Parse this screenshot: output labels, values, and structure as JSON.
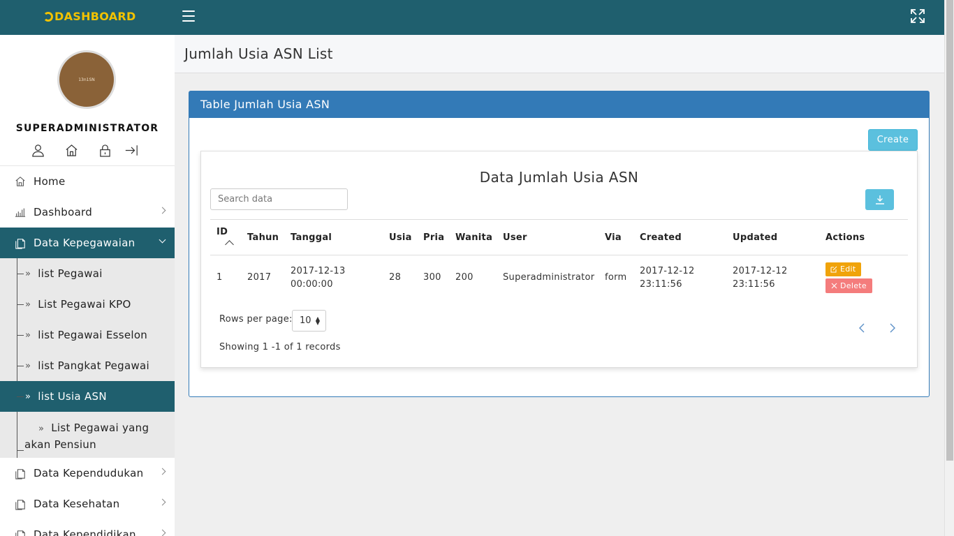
{
  "app": {
    "brand": "DASHBOARD"
  },
  "topbar": {
    "menu_icon": "hamburger-icon",
    "fullscreen_icon": "expand-icon"
  },
  "sidebar": {
    "avatar_text": "13n1SN",
    "username": "SUPERADMINISTRATOR",
    "profile_icons": [
      "user-icon",
      "home-icon",
      "lock-icon",
      "logout-icon"
    ],
    "menu": [
      {
        "label": "Home",
        "icon": "home-icon"
      },
      {
        "label": "Dashboard",
        "icon": "chart-icon"
      },
      {
        "label": "Data Kepegawaian",
        "icon": "docs-icon"
      }
    ],
    "submenu": [
      {
        "label": "list Pegawai"
      },
      {
        "label": "List Pegawai KPO"
      },
      {
        "label": "list Pegawai Esselon"
      },
      {
        "label": "list Pangkat Pegawai"
      },
      {
        "label": "list Usia ASN"
      },
      {
        "label": "List Pegawai yang akan Pensiun"
      }
    ],
    "menu_after": [
      {
        "label": "Data Kependudukan",
        "icon": "docs-icon"
      },
      {
        "label": "Data Kesehatan",
        "icon": "docs-icon"
      },
      {
        "label": "Data Kependidikan",
        "icon": "docs-icon"
      }
    ]
  },
  "page": {
    "title": "Jumlah Usia ASN List"
  },
  "panel": {
    "title": "Table Jumlah Usia ASN",
    "create_label": "Create",
    "card_title": "Data Jumlah Usia ASN",
    "search_placeholder": "Search data",
    "table": {
      "columns": [
        "ID",
        "Tahun",
        "Tanggal",
        "Usia",
        "Pria",
        "Wanita",
        "User",
        "Via",
        "Created",
        "Updated",
        "Actions"
      ],
      "rows": [
        {
          "id": "1",
          "tahun": "2017",
          "tanggal_date": "2017-12-13",
          "tanggal_time": "00:00:00",
          "usia": "28",
          "pria": "300",
          "wanita": "200",
          "user": "Superadministrator",
          "via": "form",
          "created_date": "2017-12-12",
          "created_time": "23:11:56",
          "updated_date": "2017-12-12",
          "updated_time": "23:11:56"
        }
      ],
      "edit_label": "Edit",
      "delete_label": "Delete"
    },
    "rows_per_page_label": "Rows per page:",
    "rows_per_page_value": "10",
    "showing": "Showing 1 -1 of 1 records"
  },
  "colors": {
    "topbar": "#1f5f6e",
    "brand": "#f2c200",
    "panel": "#337ab7",
    "info": "#5bc0de",
    "edit": "#f0a30a",
    "delete": "#f47c7c"
  }
}
